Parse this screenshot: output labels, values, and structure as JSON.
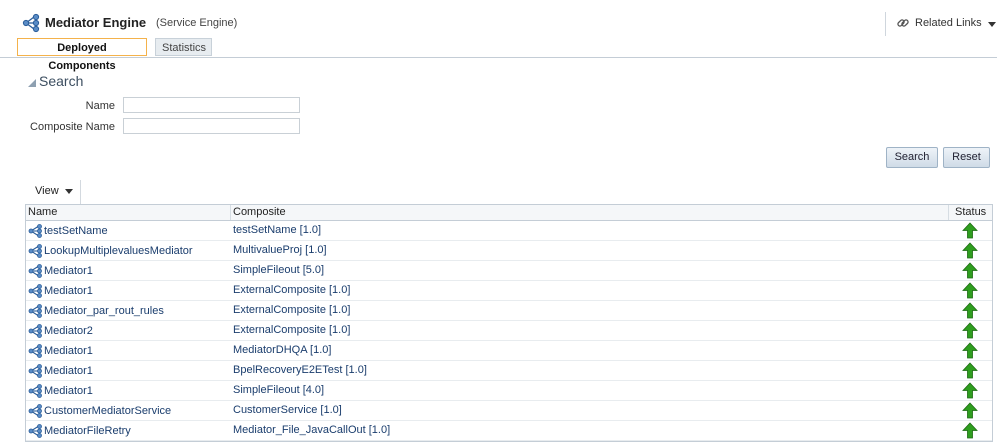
{
  "header": {
    "title": "Mediator Engine",
    "subtitle": "(Service Engine)",
    "related_links": "Related Links"
  },
  "tabs": [
    {
      "label": "Deployed Components",
      "active": true
    },
    {
      "label": "Statistics",
      "active": false
    }
  ],
  "search": {
    "title": "Search",
    "name_label": "Name",
    "name_value": "",
    "composite_label": "Composite Name",
    "composite_value": "",
    "search_button": "Search",
    "reset_button": "Reset"
  },
  "toolbar": {
    "view_label": "View"
  },
  "table": {
    "columns": [
      "Name",
      "Composite",
      "Status"
    ],
    "rows": [
      {
        "name": "testSetName",
        "composite": "testSetName [1.0]",
        "status": "up"
      },
      {
        "name": "LookupMultiplevaluesMediator",
        "composite": "MultivalueProj [1.0]",
        "status": "up"
      },
      {
        "name": "Mediator1",
        "composite": "SimpleFileout [5.0]",
        "status": "up"
      },
      {
        "name": "Mediator1",
        "composite": "ExternalComposite [1.0]",
        "status": "up"
      },
      {
        "name": "Mediator_par_rout_rules",
        "composite": "ExternalComposite [1.0]",
        "status": "up"
      },
      {
        "name": "Mediator2",
        "composite": "ExternalComposite [1.0]",
        "status": "up"
      },
      {
        "name": "Mediator1",
        "composite": "MediatorDHQA [1.0]",
        "status": "up"
      },
      {
        "name": "Mediator1",
        "composite": "BpelRecoveryE2ETest [1.0]",
        "status": "up"
      },
      {
        "name": "Mediator1",
        "composite": "SimpleFileout [4.0]",
        "status": "up"
      },
      {
        "name": "CustomerMediatorService",
        "composite": "CustomerService [1.0]",
        "status": "up"
      },
      {
        "name": "MediatorFileRetry",
        "composite": "Mediator_File_JavaCallOut [1.0]",
        "status": "up"
      }
    ]
  },
  "colors": {
    "status_up": "#2f9e1f",
    "link": "#1a3d6d",
    "active_tab_border": "#f4b24b"
  },
  "icons": {
    "engine": "mediator-engine-icon",
    "component": "mediator-component-icon",
    "related": "link-chain-icon",
    "status_up": "status-up-arrow-icon"
  }
}
